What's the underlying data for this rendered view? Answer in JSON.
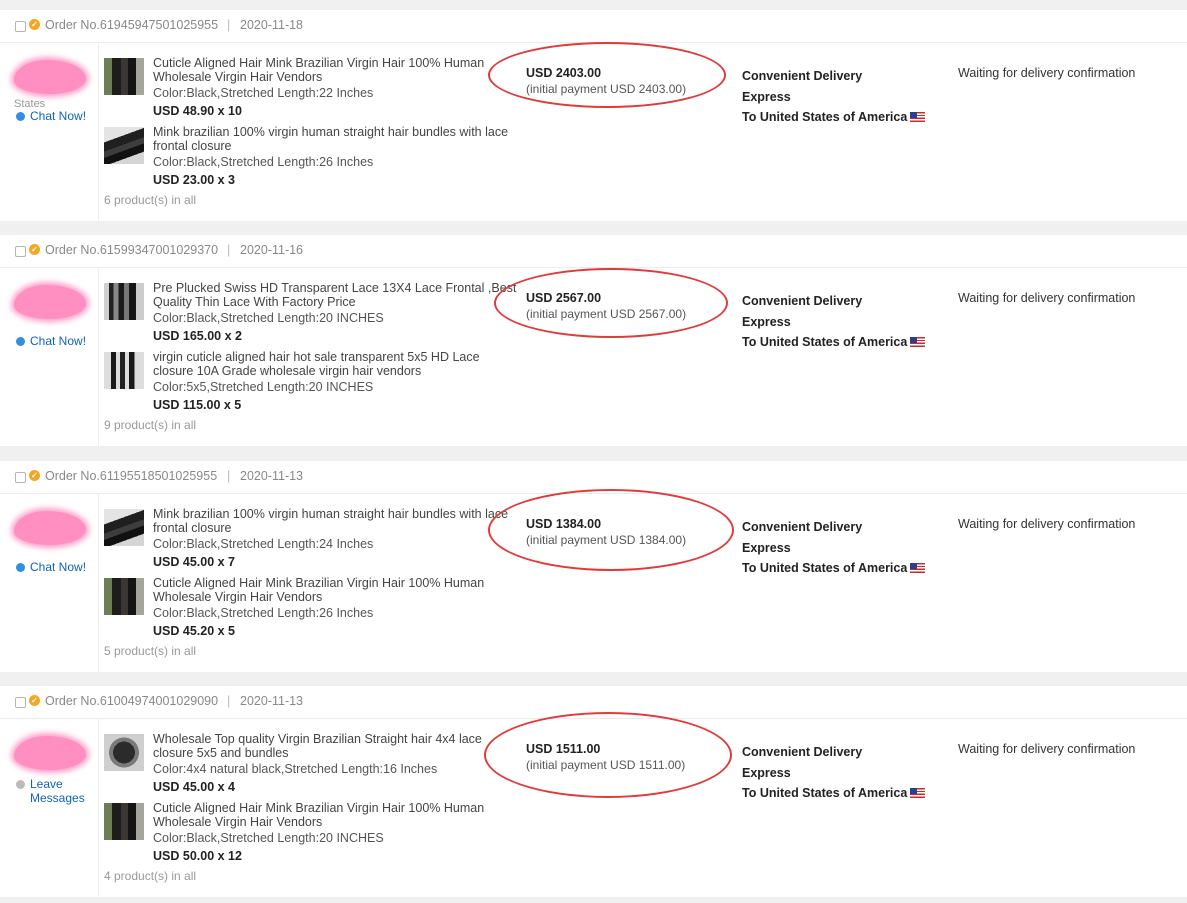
{
  "orders": [
    {
      "order_label": "Order No.",
      "order_no": "61945947501025955",
      "date": "2020-11-18",
      "seller_hint": "States",
      "contact": "Chat Now!",
      "amount": "USD 2403.00",
      "initial_payment": "(initial payment USD 2403.00)",
      "delivery_line1": "Convenient Delivery",
      "delivery_line2": "Express",
      "delivery_line3": "To United States of America",
      "status": "Waiting for delivery confirmation",
      "products_count": "6 product(s) in all",
      "items": [
        {
          "title": "Cuticle Aligned Hair Mink Brazilian Virgin Hair 100% Human Wholesale Virgin Hair Vendors",
          "attr": "Color:Black,Stretched Length:22 Inches",
          "price": "USD 48.90 x 10"
        },
        {
          "title": "Mink brazilian 100% virgin human straight hair bundles with lace frontal closure",
          "attr": "Color:Black,Stretched Length:26 Inches",
          "price": "USD 23.00 x 3"
        }
      ]
    },
    {
      "order_label": "Order No.",
      "order_no": "61599347001029370",
      "date": "2020-11-16",
      "seller_hint": "",
      "contact": "Chat Now!",
      "amount": "USD 2567.00",
      "initial_payment": "(initial payment USD 2567.00)",
      "delivery_line1": "Convenient Delivery",
      "delivery_line2": "Express",
      "delivery_line3": "To United States of America",
      "status": "Waiting for delivery confirmation",
      "products_count": "9 product(s) in all",
      "items": [
        {
          "title": "Pre Plucked Swiss HD Transparent Lace 13X4 Lace Frontal ,Best Quality Thin Lace With Factory Price",
          "attr": "Color:Black,Stretched Length:20 INCHES",
          "price": "USD 165.00 x 2"
        },
        {
          "title": "virgin cuticle aligned hair hot sale transparent 5x5 HD Lace closure 10A Grade wholesale virgin hair vendors",
          "attr": "Color:5x5,Stretched Length:20 INCHES",
          "price": "USD 115.00 x 5"
        }
      ]
    },
    {
      "order_label": "Order No.",
      "order_no": "61195518501025955",
      "date": "2020-11-13",
      "seller_hint": "",
      "contact": "Chat Now!",
      "amount": "USD 1384.00",
      "initial_payment": "(initial payment USD 1384.00)",
      "delivery_line1": "Convenient Delivery",
      "delivery_line2": "Express",
      "delivery_line3": "To United States of America",
      "status": "Waiting for delivery confirmation",
      "products_count": "5 product(s) in all",
      "items": [
        {
          "title": "Mink brazilian 100% virgin human straight hair bundles with lace frontal closure",
          "attr": "Color:Black,Stretched Length:24 Inches",
          "price": "USD 45.00 x 7"
        },
        {
          "title": "Cuticle Aligned Hair Mink Brazilian Virgin Hair 100% Human Wholesale Virgin Hair Vendors",
          "attr": "Color:Black,Stretched Length:26 Inches",
          "price": "USD 45.20 x 5"
        }
      ]
    },
    {
      "order_label": "Order No.",
      "order_no": "61004974001029090",
      "date": "2020-11-13",
      "seller_hint": "",
      "contact": "Leave Messages",
      "amount": "USD 1511.00",
      "initial_payment": "(initial payment USD 1511.00)",
      "delivery_line1": "Convenient Delivery",
      "delivery_line2": "Express",
      "delivery_line3": "To United States of America",
      "status": "Waiting for delivery confirmation",
      "products_count": "4 product(s) in all",
      "items": [
        {
          "title": "Wholesale Top quality Virgin Brazilian Straight hair 4x4 lace closure 5x5 and bundles",
          "attr": "Color:4x4 natural black,Stretched Length:16 Inches",
          "price": "USD 45.00 x 4"
        },
        {
          "title": "Cuticle Aligned Hair Mink Brazilian Virgin Hair 100% Human Wholesale Virgin Hair Vendors",
          "attr": "Color:Black,Stretched Length:20 INCHES",
          "price": "USD 50.00 x 12"
        }
      ]
    }
  ],
  "colors": {
    "accent_link": "#0e63b7",
    "highlight_circle": "#e23a3a",
    "redaction": "#ff8fc1",
    "order_icon": "#f5a623"
  },
  "icons": [
    "checkbox-icon",
    "order-badge-icon",
    "chat-icon",
    "message-icon",
    "us-flag-icon"
  ]
}
